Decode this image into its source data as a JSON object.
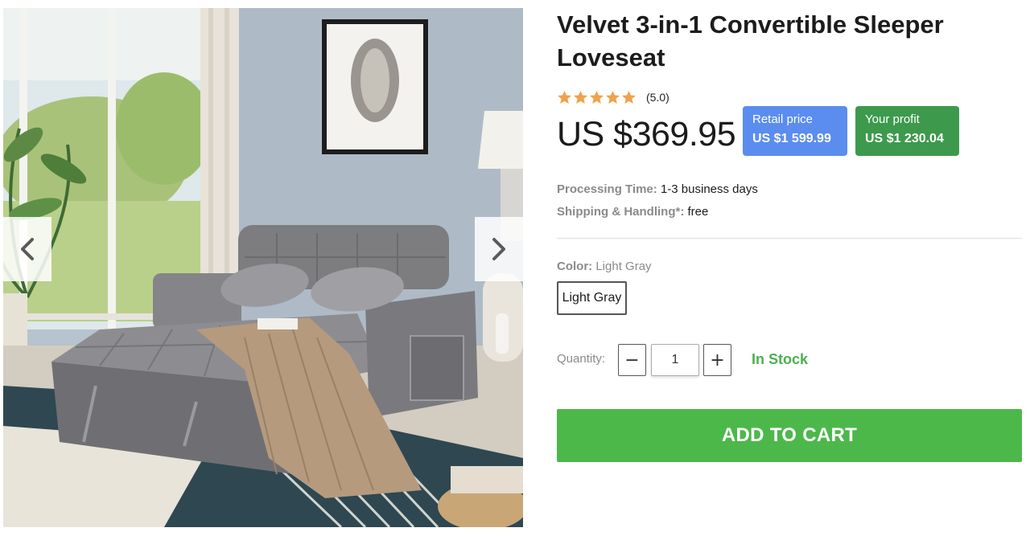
{
  "product": {
    "title": "Velvet 3-in-1 Convertible Sleeper Loveseat",
    "rating": {
      "stars": 5,
      "text": "(5.0)"
    },
    "price": "US $369.95",
    "retail": {
      "label": "Retail price",
      "value": "US $1 599.99"
    },
    "profit": {
      "label": "Your profit",
      "value": "US $1 230.04"
    },
    "processing": {
      "label": "Processing Time:",
      "value": "1-3 business days"
    },
    "shipping": {
      "label": "Shipping & Handling*:",
      "value": "free"
    },
    "color": {
      "label": "Color:",
      "value": "Light Gray",
      "options": [
        "Light Gray"
      ]
    },
    "quantity": {
      "label": "Quantity:",
      "value": "1",
      "minus": "−",
      "plus": "+"
    },
    "stock": "In Stock",
    "add_to_cart": "ADD TO CART"
  },
  "gallery": {
    "prev_icon": "chevron-left-icon",
    "next_icon": "chevron-right-icon"
  },
  "colors": {
    "retail_badge": "#5b8def",
    "profit_badge": "#3d9a4c",
    "in_stock": "#4caf50",
    "add_to_cart": "#4cb84a",
    "star": "#f0a24a"
  }
}
